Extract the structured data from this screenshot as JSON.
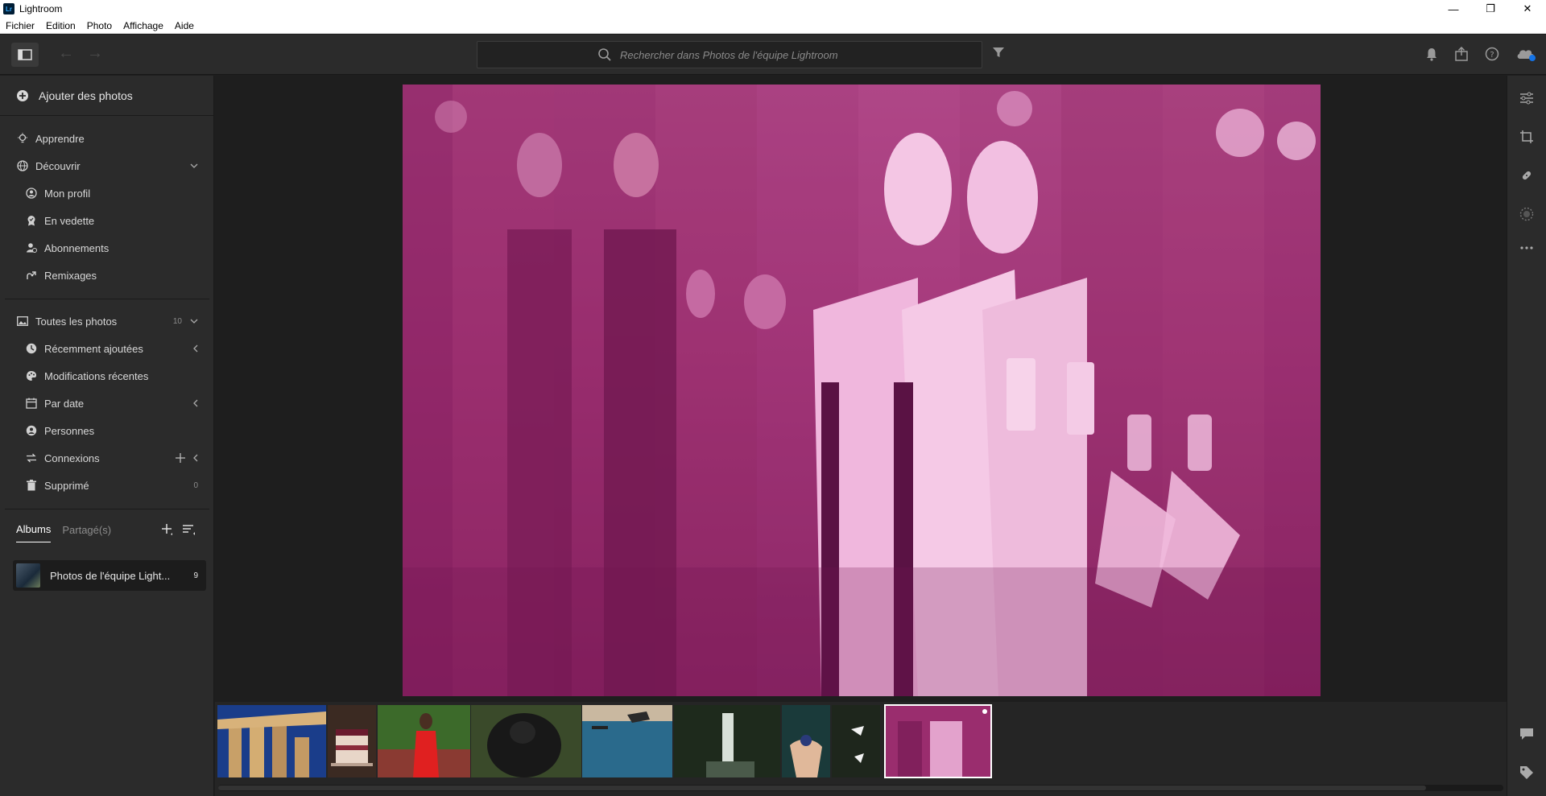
{
  "window": {
    "title": "Lightroom",
    "logo_text": "Lr",
    "minimize": "—",
    "maximize": "❐",
    "close": "✕"
  },
  "menu": [
    "Fichier",
    "Edition",
    "Photo",
    "Affichage",
    "Aide"
  ],
  "toolbar": {
    "search_placeholder": "Rechercher dans Photos de l'équipe Lightroom",
    "back": "←",
    "forward": "→"
  },
  "sidebar": {
    "add_photos": "Ajouter des photos",
    "learn": "Apprendre",
    "discover": "Découvrir",
    "discover_items": [
      "Mon profil",
      "En vedette",
      "Abonnements",
      "Remixages"
    ],
    "library": {
      "all_photos": "Toutes les photos",
      "all_photos_count": "10",
      "recently_added": "Récemment ajoutées",
      "recent_edits": "Modifications récentes",
      "by_date": "Par date",
      "people": "Personnes",
      "connections": "Connexions",
      "deleted": "Supprimé",
      "deleted_count": "0"
    },
    "tabs": {
      "albums": "Albums",
      "shared": "Partagé(s)"
    },
    "album": {
      "name": "Photos de l'équipe Light...",
      "count": "9"
    }
  },
  "colors": {
    "panel_bg": "#2b2b2b",
    "main_bg": "#1e1e1e",
    "text": "#d8d8d8",
    "photo_tint": "#b03882",
    "sync_accent": "#1473e6"
  },
  "filmstrip": {
    "thumbnails": [
      {
        "name": "greek-columns"
      },
      {
        "name": "berry-cake"
      },
      {
        "name": "woman-red-dress"
      },
      {
        "name": "gorilla"
      },
      {
        "name": "ocean-whale"
      },
      {
        "name": "waterfall-forest"
      },
      {
        "name": "hand-blueberries"
      },
      {
        "name": "white-flowers"
      },
      {
        "name": "pink-people",
        "selected": true
      }
    ]
  }
}
